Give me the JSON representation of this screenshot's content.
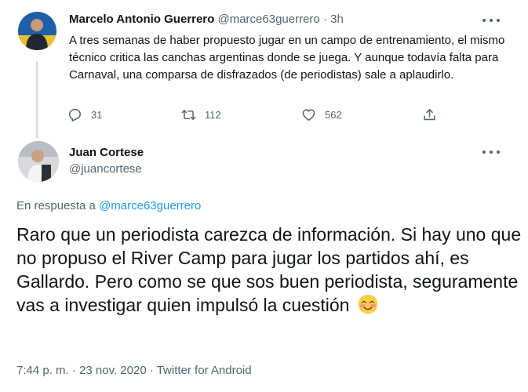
{
  "tweet1": {
    "author_name": "Marcelo Antonio Guerrero",
    "handle": "@marce63guerrero",
    "separator": " · ",
    "time": "3h",
    "text": "A tres semanas de haber propuesto jugar en un campo de entrenamiento, el mismo técnico critica las canchas argentinas donde se juega. Y aunque todavía falta para Carnaval, una comparsa de disfrazados (de periodistas) sale a aplaudirlo.",
    "reply_count": "31",
    "retweet_count": "112",
    "like_count": "562",
    "icons": [
      "more-icon",
      "reply-icon",
      "retweet-icon",
      "like-icon",
      "share-icon"
    ]
  },
  "tweet2": {
    "author_name": "Juan Cortese",
    "handle": "@juancortese",
    "reply_prefix": "En respuesta a ",
    "reply_mention": "@marce63guerrero",
    "text": "Raro que un periodista carezca de información. Si hay uno que no propuso el River Camp para jugar los partidos ahí, es Gallardo. Pero como se que sos buen periodista, seguramente vas a investigar quien impulsó la cuestión",
    "emoji": "smiling-face-with-blush-emoji",
    "timestamp": "7:44 p. m. · 23 nov. 2020 · Twitter for Android"
  },
  "colors": {
    "accent": "#1d9bf0",
    "text": "#0f1419",
    "secondary": "#536471",
    "thread_line": "#cfd9de"
  }
}
